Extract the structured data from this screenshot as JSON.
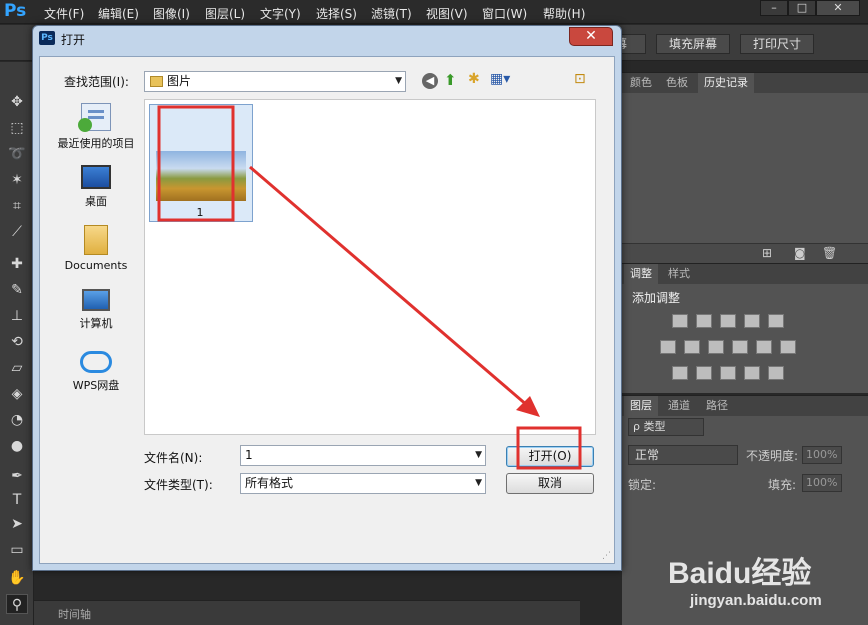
{
  "app": {
    "logo": "Ps",
    "menu": [
      "文件(F)",
      "编辑(E)",
      "图像(I)",
      "图层(L)",
      "文字(Y)",
      "选择(S)",
      "滤镜(T)",
      "视图(V)",
      "窗口(W)",
      "帮助(H)"
    ],
    "window_buttons": [
      "–",
      "□",
      "✕"
    ]
  },
  "options_bar": {
    "buttons": [
      "幕",
      "填充屏幕",
      "打印尺寸"
    ]
  },
  "panels": {
    "history": {
      "tabs": [
        "颜色",
        "色板",
        "历史记录"
      ],
      "active": "历史记录"
    },
    "adjustments": {
      "tabs": [
        "调整",
        "样式"
      ],
      "title": "添加调整"
    },
    "layers": {
      "tabs": [
        "图层",
        "通道",
        "路径"
      ],
      "filter_label": "ρ 类型",
      "blend_mode": "正常",
      "opacity_label": "不透明度:",
      "opacity_value": "100%",
      "lock_label": "锁定:",
      "fill_label": "填充:",
      "fill_value": "100%"
    }
  },
  "timeline": {
    "label": "时间轴"
  },
  "dialog": {
    "title": "打开",
    "close": "✕",
    "lookin_label": "查找范围(I):",
    "lookin_value": "图片",
    "places": [
      {
        "label": "最近使用的项目",
        "icon": "recent-icon"
      },
      {
        "label": "桌面",
        "icon": "desktop-icon"
      },
      {
        "label": "Documents",
        "icon": "folder-icon"
      },
      {
        "label": "计算机",
        "icon": "computer-icon"
      },
      {
        "label": "WPS网盘",
        "icon": "cloud-icon"
      }
    ],
    "file": {
      "name": "1"
    },
    "filename_label": "文件名(N):",
    "filename_value": "1",
    "filetype_label": "文件类型(T):",
    "filetype_value": "所有格式",
    "open_button": "打开(O)",
    "cancel_button": "取消"
  },
  "watermark": {
    "brand": "Baidu经验",
    "url": "jingyan.baidu.com"
  },
  "colors": {
    "annotation": "#e0312e",
    "ps_blue": "#33a4ff"
  }
}
